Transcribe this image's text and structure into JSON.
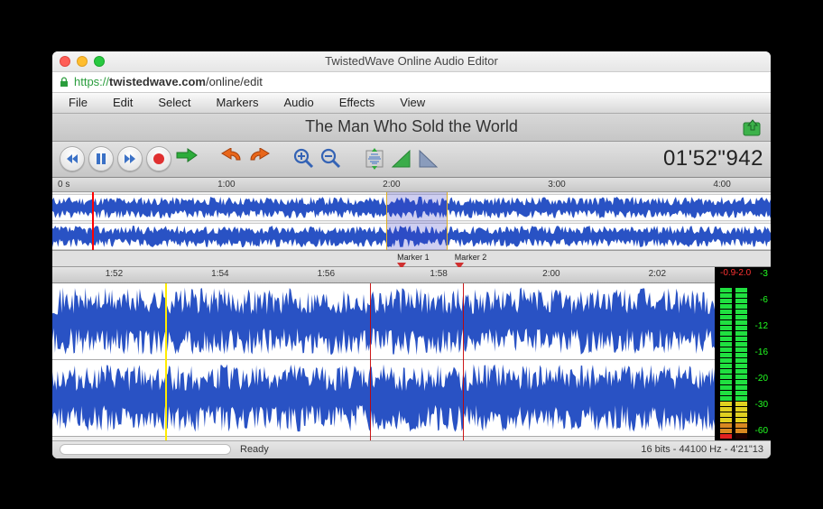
{
  "window": {
    "title": "TwistedWave Online Audio Editor"
  },
  "url": {
    "scheme": "https://",
    "host": "twistedwave.com",
    "path": "/online/edit"
  },
  "menu": [
    "File",
    "Edit",
    "Select",
    "Markers",
    "Audio",
    "Effects",
    "View"
  ],
  "document": {
    "title": "The Man Who Sold the World"
  },
  "transport": {
    "timecode": "01'52\"942"
  },
  "ruler_overview": {
    "ticks": [
      "0 s",
      "1:00",
      "2:00",
      "3:00",
      "4:00"
    ]
  },
  "zoom_ruler": {
    "ticks": [
      "1:52",
      "1:54",
      "1:56",
      "1:58",
      "2:00",
      "2:02"
    ]
  },
  "markers": [
    {
      "label": "Marker 1",
      "pos_pct": 48.0
    },
    {
      "label": "Marker 2",
      "pos_pct": 56.0
    }
  ],
  "selection": {
    "start_pct": 46.5,
    "end_pct": 55.0
  },
  "playhead_overview_pct": 5.5,
  "cursor_zoom_pct": 17.0,
  "selection_zoom": {
    "start_pct": 48.0,
    "end_pct": 62.0
  },
  "meter": {
    "peaks": [
      "-0.9",
      "-2.0"
    ],
    "scale": [
      "-3",
      "-6",
      "-12",
      "-16",
      "-20",
      "-30",
      "-60"
    ]
  },
  "status": {
    "left": "Ready",
    "right": "16 bits - 44100 Hz - 4'21\"13"
  },
  "icons": {
    "rewind": "rewind",
    "pause": "pause",
    "forward": "forward",
    "record": "record",
    "play": "play",
    "undo": "undo",
    "redo": "redo",
    "zoomin": "zoom-in",
    "zoomout": "zoom-out",
    "fitv": "fit-vertical",
    "fadein": "fade-in",
    "fadeout": "fade-out",
    "save": "save"
  }
}
